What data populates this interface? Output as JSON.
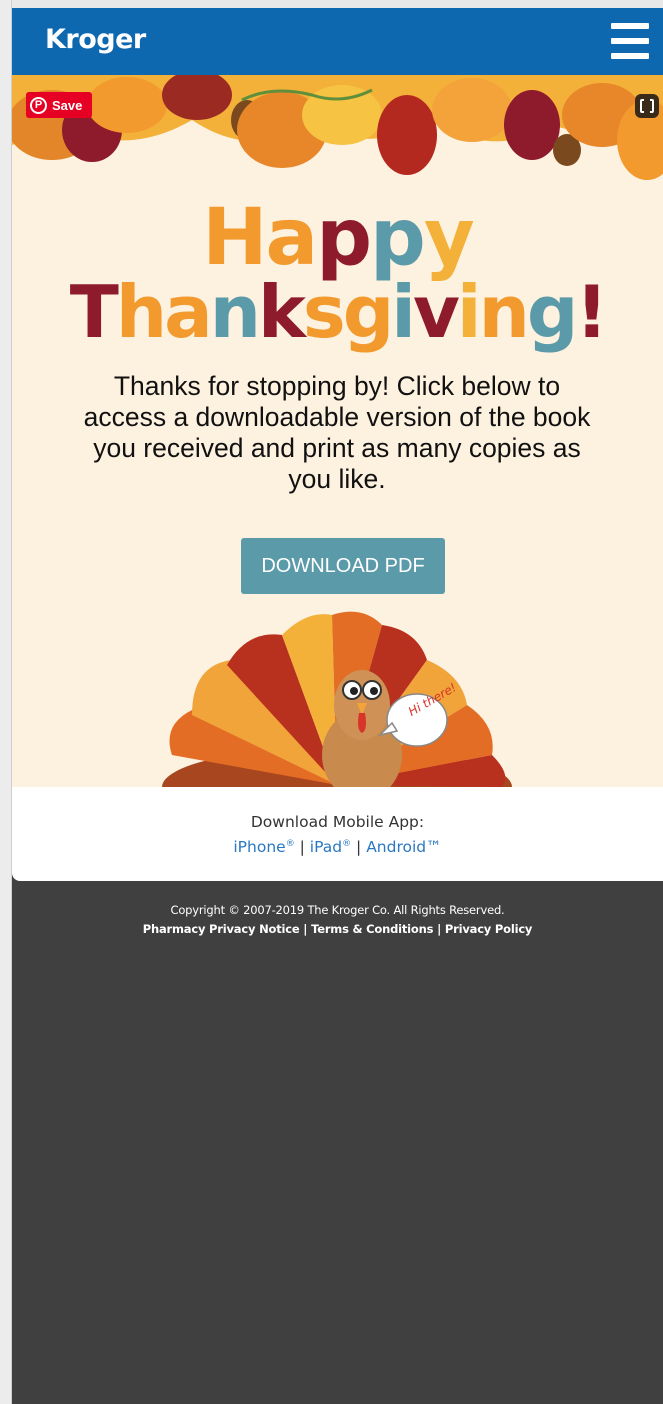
{
  "header": {
    "brand": "Kroger",
    "menu_icon": "hamburger-menu-icon",
    "color": "#0e68b0"
  },
  "hero": {
    "pin_save_label": "Save",
    "title_line1": [
      "H",
      "a",
      "p",
      "p",
      "y"
    ],
    "title_line2": [
      "T",
      "h",
      "a",
      "n",
      "k",
      "s",
      "g",
      "i",
      "v",
      "i",
      "n",
      "g",
      "!"
    ],
    "body": "Thanks for stopping by! Click below to access a downloadable version of the book you received and print as many copies as you like.",
    "download_label": "DOWNLOAD PDF",
    "speech_bubble": "Hi there!",
    "colors": {
      "orange": "#f39a2e",
      "maroon": "#8e1b2c",
      "teal": "#5b9aa9",
      "background": "#fdf1df"
    }
  },
  "app_strip": {
    "label": "Download Mobile App:",
    "iphone": "iPhone",
    "ipad": "iPad",
    "android": "Android™",
    "registered": "®",
    "separator": "|"
  },
  "footer": {
    "copyright": "Copyright © 2007-2019 The Kroger Co. All Rights Reserved.",
    "links": [
      "Pharmacy Privacy Notice",
      "Terms & Conditions",
      "Privacy Policy"
    ],
    "separator": "|"
  }
}
